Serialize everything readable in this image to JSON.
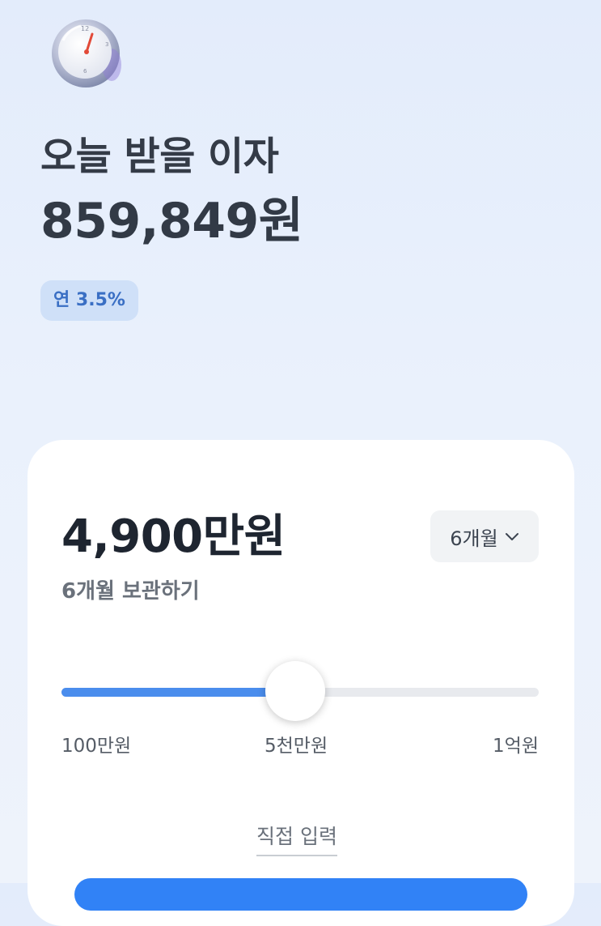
{
  "header": {
    "headline": "오늘 받을 이자",
    "interest_amount": "859,849원",
    "rate_badge": "연 3.5%"
  },
  "deposit": {
    "amount": "4,900만원",
    "period_select": "6개월",
    "keep_text": "6개월 보관하기",
    "slider": {
      "value_fraction": 0.49,
      "min_label": "100만원",
      "mid_label": "5천만원",
      "max_label": "1억원"
    },
    "direct_input_label": "직접 입력"
  },
  "colors": {
    "accent": "#4a8ded",
    "badge_bg": "#cfe0f8",
    "badge_text": "#3a6fc4"
  }
}
